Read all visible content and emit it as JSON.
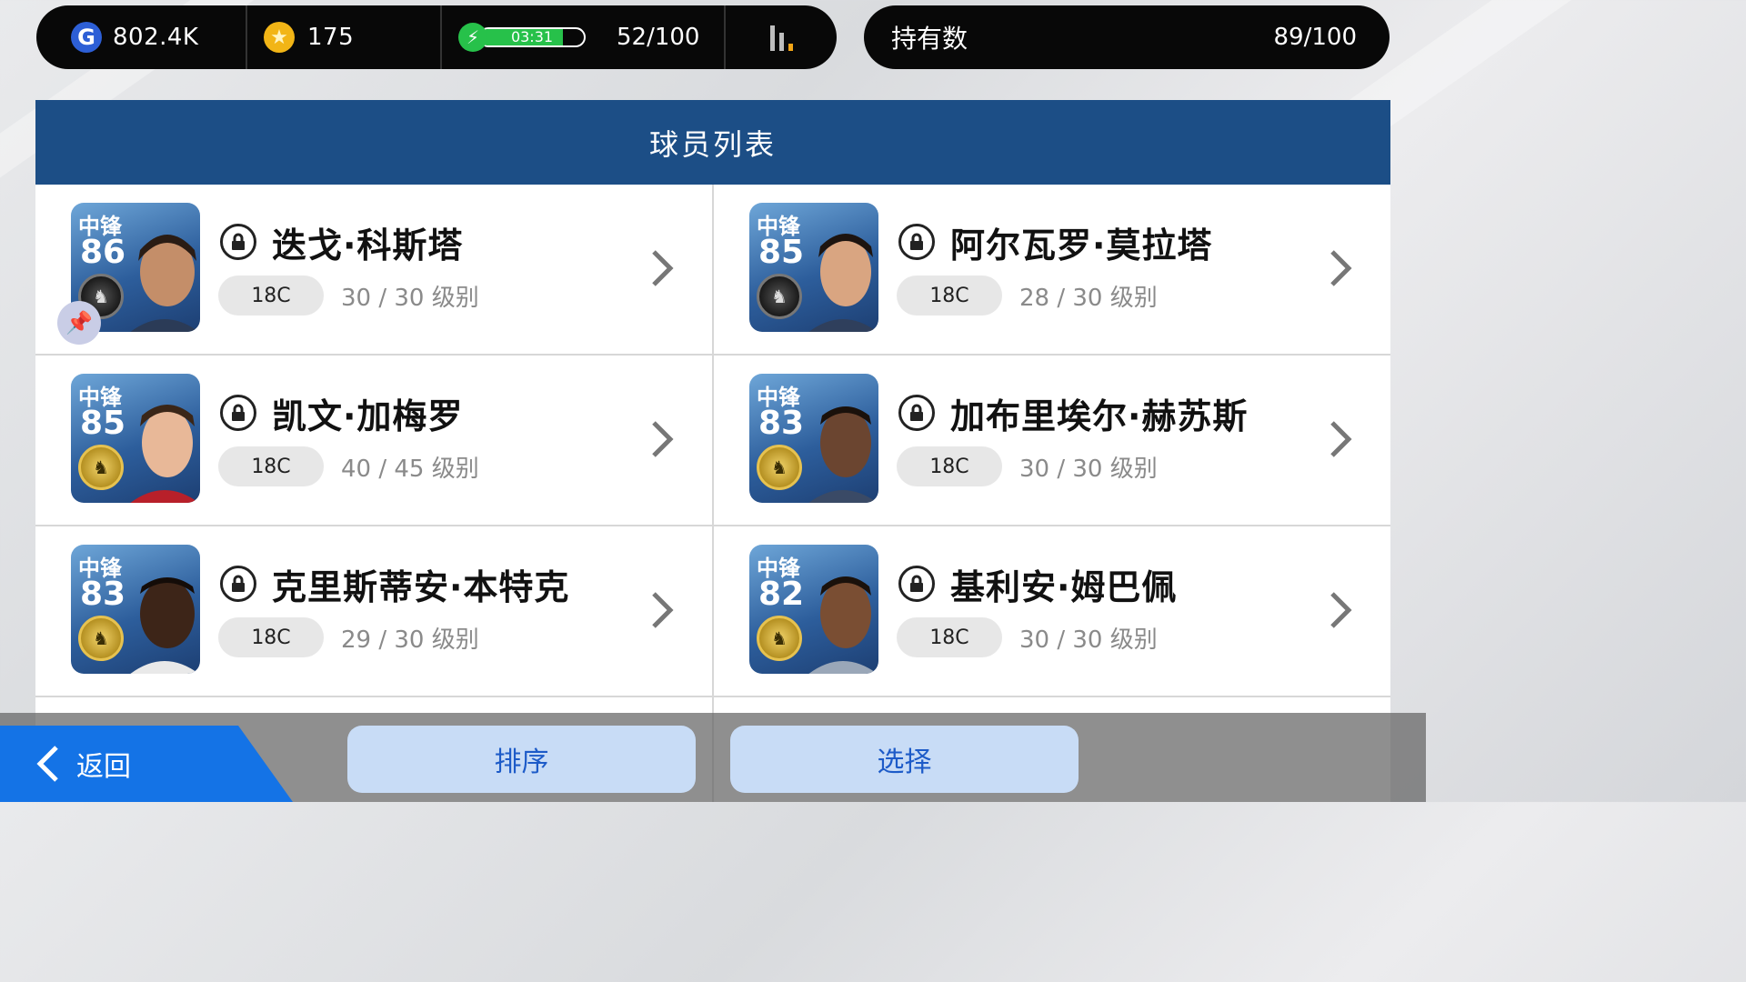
{
  "resources": {
    "gp": "802.4K",
    "coins": "175",
    "energy_timer": "03:31",
    "energy_fill_fraction": 0.8,
    "energy_count": "52/100"
  },
  "ownership": {
    "label": "持有数",
    "count": "89/100"
  },
  "list": {
    "title": "球员列表",
    "players": [
      {
        "position": "中锋",
        "rating": "86",
        "name": "迭戈·科斯塔",
        "tag": "18C",
        "level": "30 / 30 级别",
        "badge": "black",
        "pinned": true
      },
      {
        "position": "中锋",
        "rating": "85",
        "name": "阿尔瓦罗·莫拉塔",
        "tag": "18C",
        "level": "28 / 30 级别",
        "badge": "black",
        "pinned": false
      },
      {
        "position": "中锋",
        "rating": "85",
        "name": "凯文·加梅罗",
        "tag": "18C",
        "level": "40 / 45 级别",
        "badge": "gold",
        "pinned": false
      },
      {
        "position": "中锋",
        "rating": "83",
        "name": "加布里埃尔·赫苏斯",
        "tag": "18C",
        "level": "30 / 30 级别",
        "badge": "gold",
        "pinned": false
      },
      {
        "position": "中锋",
        "rating": "83",
        "name": "克里斯蒂安·本特克",
        "tag": "18C",
        "level": "29 / 30 级别",
        "badge": "gold",
        "pinned": false
      },
      {
        "position": "中锋",
        "rating": "82",
        "name": "基利安·姆巴佩",
        "tag": "18C",
        "level": "30 / 30 级别",
        "badge": "gold",
        "pinned": false
      }
    ]
  },
  "bottom": {
    "back_label": "返回",
    "sort_label": "排序",
    "select_label": "选择"
  },
  "colors": {
    "header_blue": "#1c4e86",
    "energy_green": "#27c14a",
    "back_blue": "#1473e6",
    "pill_bg": "#c8dcf6"
  }
}
